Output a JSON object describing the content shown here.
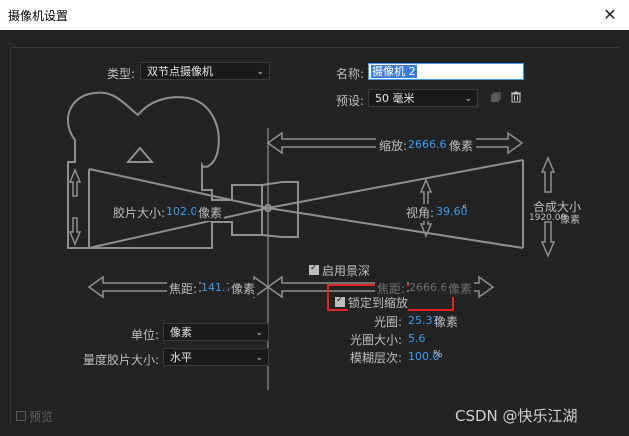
{
  "window": {
    "title": "摄像机设置",
    "close_glyph": "✕"
  },
  "type": {
    "label": "类型:",
    "value": "双节点摄像机"
  },
  "name": {
    "label": "名称:",
    "value": "摄像机 2"
  },
  "preset": {
    "label": "预设:",
    "value": "50 毫米"
  },
  "zoom": {
    "label": "缩放:",
    "value": "2666.67",
    "unit": "像素"
  },
  "film_size": {
    "label": "胶片大小:",
    "value": "102.05",
    "unit": "像素"
  },
  "angle": {
    "label": "视角:",
    "value": "39.60",
    "unit": "°"
  },
  "comp_size": {
    "label": "合成大小",
    "value": "1920.00",
    "unit": "像素"
  },
  "enable_dof": {
    "label": "启用景深",
    "checked": true
  },
  "focal_length": {
    "label": "焦距:",
    "value": "141.73",
    "unit": "像素"
  },
  "focus_distance": {
    "label": "焦距:",
    "value": "2666.67",
    "unit": "像素"
  },
  "lock_zoom": {
    "label": "锁定到缩放",
    "checked": true
  },
  "aperture": {
    "label": "光圈:",
    "value": "25.31",
    "unit": "像素"
  },
  "f_stop": {
    "label": "光圈大小:",
    "value": "5.6"
  },
  "blur_level": {
    "label": "模糊层次:",
    "value": "100.0",
    "unit": "%"
  },
  "units": {
    "label": "单位:",
    "value": "像素"
  },
  "measure_film": {
    "label": "量度胶片大小:",
    "value": "水平"
  },
  "preview": {
    "label": "预览",
    "checked": false
  },
  "watermark": "CSDN @快乐江湖",
  "colors": {
    "accent": "#3c9cf2",
    "highlight_box": "#e02424",
    "background": "#232323"
  }
}
